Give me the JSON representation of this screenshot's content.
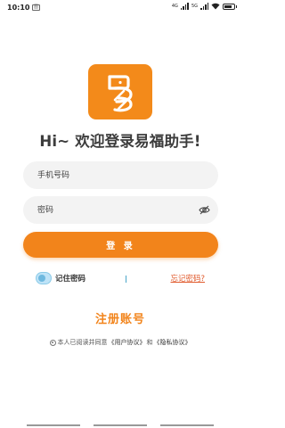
{
  "status_bar": {
    "time": "10:10",
    "badge": "图",
    "network": "4G",
    "network2": "5G",
    "battery_level": 0.8
  },
  "logo": {
    "icon": "yi-logo-icon",
    "color": "#f38a1a"
  },
  "welcome_text": "Hi~ 欢迎登录易福助手!",
  "phone_field": {
    "placeholder": "手机号码",
    "value": ""
  },
  "password_field": {
    "placeholder": "密码",
    "value": "",
    "toggle_icon": "eye-hidden-icon"
  },
  "login_button": {
    "label": "登 录",
    "color": "#f2841b"
  },
  "remember": {
    "label": "记住密码",
    "checked": true
  },
  "forgot_link": "忘记密码?",
  "register_link": "注册账号",
  "agreement": {
    "prefix": "本人已阅读并同意",
    "user_agreement": "《用户协议》",
    "conjunction": "和",
    "privacy_policy": "《隐私协议》"
  }
}
